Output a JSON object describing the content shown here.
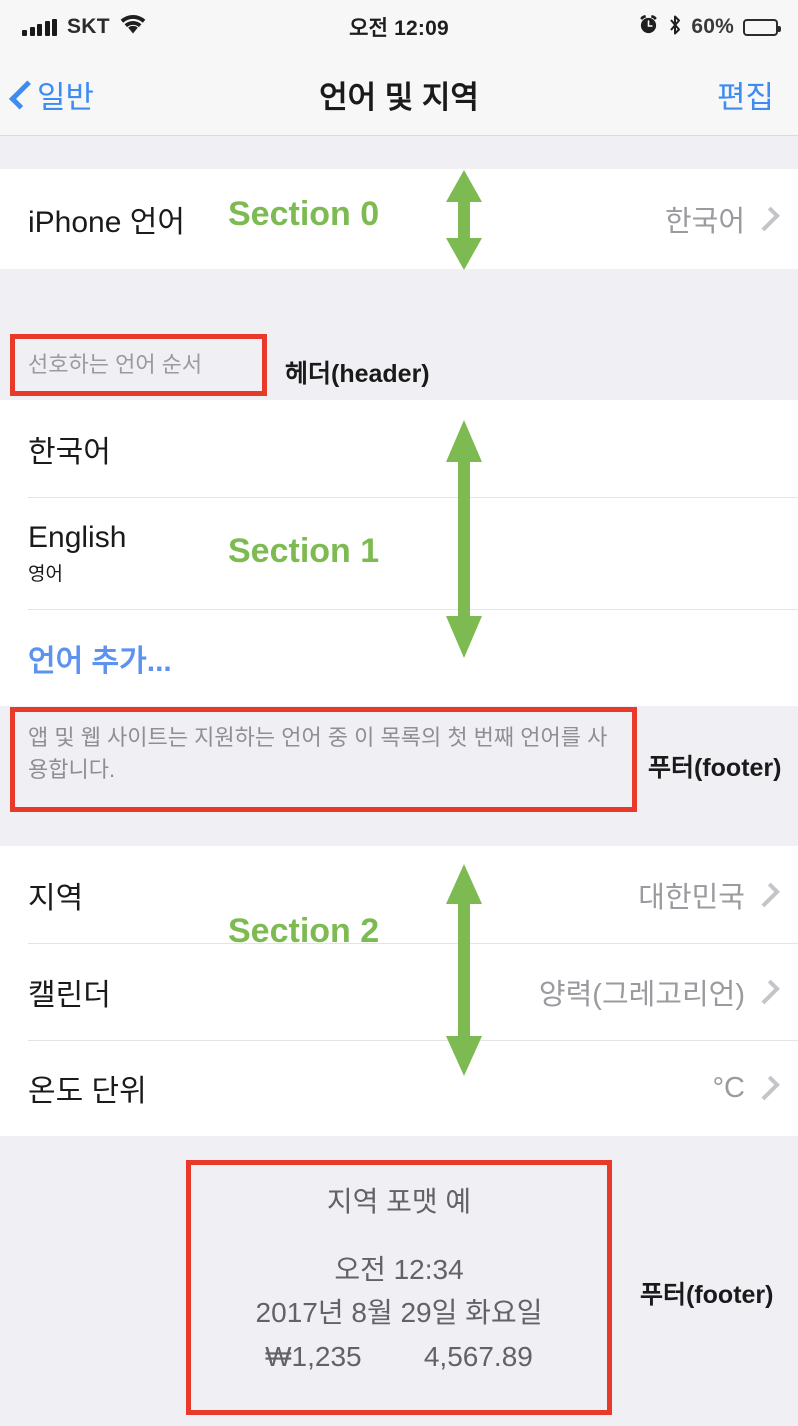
{
  "status_bar": {
    "carrier": "SKT",
    "signal_icon": "signal-bars-icon",
    "wifi_icon": "wifi-icon",
    "time": "오전 12:09",
    "alarm_icon": "alarm-clock-icon",
    "bluetooth_icon": "bluetooth-icon",
    "battery_percent": "60%",
    "battery_level": 60
  },
  "nav_bar": {
    "back_label": "일반",
    "back_icon": "chevron-left-icon",
    "title": "언어 및 지역",
    "edit_label": "편집"
  },
  "sections": [
    {
      "id": "section0",
      "annotation": "Section 0",
      "rows": [
        {
          "title": "iPhone 언어",
          "value": "한국어",
          "chevron": true
        }
      ]
    },
    {
      "id": "section1",
      "annotation": "Section 1",
      "header": "선호하는 언어 순서",
      "header_annotation": "헤더(header)",
      "rows": [
        {
          "title": "한국어",
          "value": "",
          "chevron": false
        },
        {
          "title": "English",
          "subtitle": "영어",
          "value": "",
          "chevron": false
        },
        {
          "title": "언어 추가...",
          "value": "",
          "chevron": false,
          "link": true
        }
      ],
      "footer": "앱 및 웹 사이트는 지원하는 언어 중 이 목록의 첫 번째 언어를 사용합니다.",
      "footer_annotation": "푸터(footer)"
    },
    {
      "id": "section2",
      "annotation": "Section 2",
      "rows": [
        {
          "title": "지역",
          "value": "대한민국",
          "chevron": true
        },
        {
          "title": "캘린더",
          "value": "양력(그레고리언)",
          "chevron": true
        },
        {
          "title": "온도 단위",
          "value": "°C",
          "chevron": true
        }
      ],
      "footer_annotation": "푸터(footer)",
      "footer_block": {
        "title": "지역 포맷 예",
        "lines": [
          "오전 12:34",
          "2017년 8월 29일 화요일",
          "₩1,235        4,567.89"
        ]
      }
    }
  ],
  "colors": {
    "annotation_red": "#e8392a",
    "annotation_green": "#7dbb52",
    "ios_blue": "#3e8bf2",
    "table_background": "#efeff4",
    "cell_background": "#ffffff",
    "value_gray": "#9a9a9f"
  }
}
